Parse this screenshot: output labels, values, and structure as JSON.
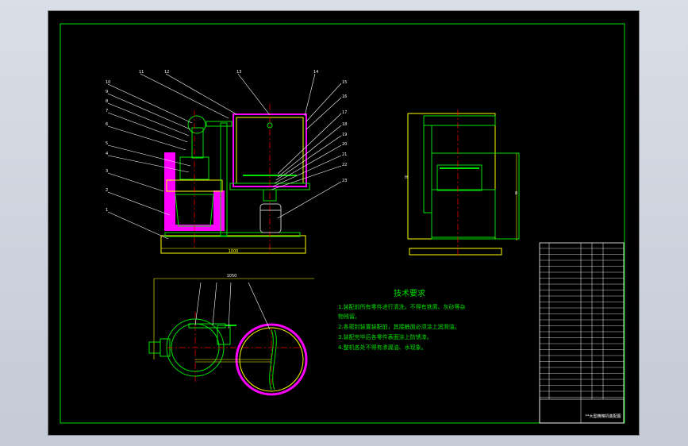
{
  "drawing": {
    "tech_requirements": {
      "title": "技术要求",
      "items": [
        "1.装配前所有零件进行清洗，不得有铁屑、灰砂等杂",
        "物残留。",
        "2.各密封装置装配前，其接触面必须涂上润滑油。",
        "3.装配完毕后各零件表面涂上防锈漆。",
        "4.整机各处不得有渗漏油、水现象。"
      ]
    },
    "dimensions": {
      "base_width": "1000",
      "plan_width": "1050",
      "side_height": "H"
    },
    "balloons": [
      "1",
      "2",
      "3",
      "4",
      "5",
      "6",
      "7",
      "8",
      "9",
      "10",
      "11",
      "12",
      "13",
      "14",
      "15",
      "16",
      "17",
      "18",
      "19",
      "20",
      "21",
      "22",
      "23"
    ],
    "title_block": {
      "drawing_name": "**大型精粮机装配图"
    },
    "colors": {
      "frame": "#00e000",
      "outline": "#ffff00",
      "section": "#ff00ff",
      "leader": "#ffffff",
      "center": "#ff0000",
      "part": "#c0c0c0"
    }
  }
}
